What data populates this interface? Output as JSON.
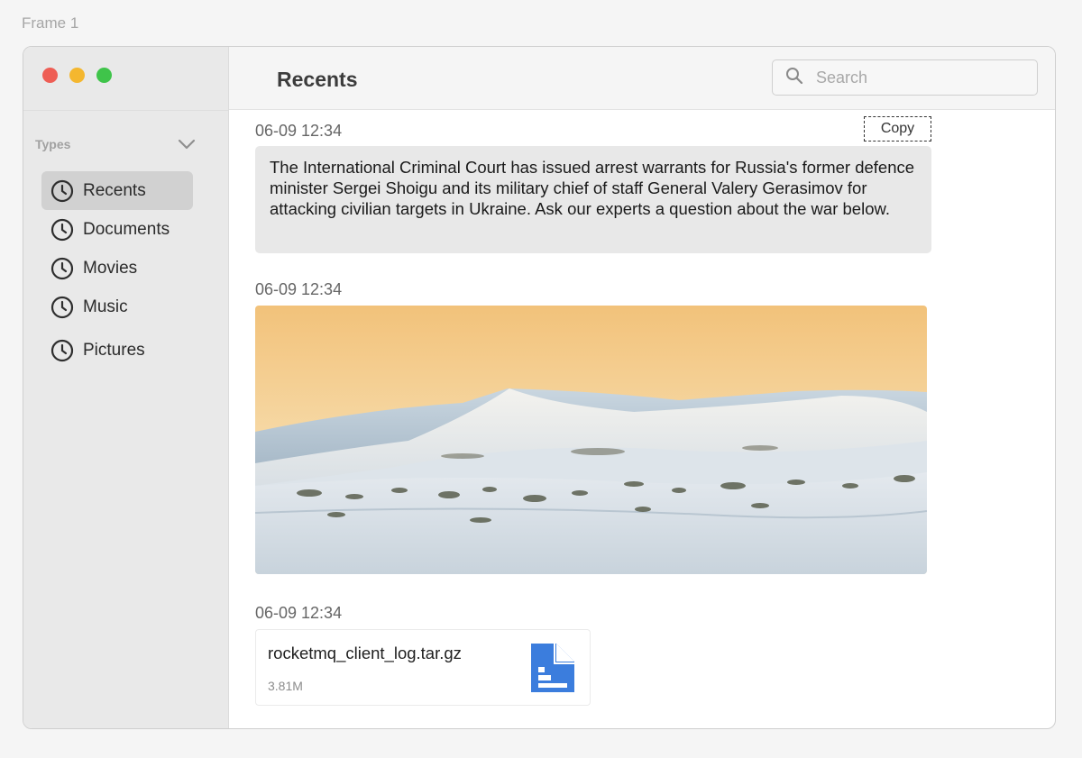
{
  "frame_label": "Frame 1",
  "sidebar": {
    "group_title": "Types",
    "items": [
      {
        "label": "Recents",
        "active": true,
        "icon": "clock-icon"
      },
      {
        "label": "Documents",
        "active": false,
        "icon": "clock-icon"
      },
      {
        "label": "Movies",
        "active": false,
        "icon": "clock-icon"
      },
      {
        "label": "Music",
        "active": false,
        "icon": "clock-icon"
      },
      {
        "label": "Pictures",
        "active": false,
        "icon": "clock-icon"
      }
    ]
  },
  "header": {
    "title": "Recents",
    "search_placeholder": "Search"
  },
  "messages": [
    {
      "timestamp": "06-09 12:34",
      "type": "text",
      "copy_label": "Copy",
      "text": "The International Criminal Court has issued arrest warrants for Russia's former defence minister Sergei Shoigu and its military chief of staff General Valery Gerasimov for attacking civilian targets in Ukraine. Ask our experts a question about the war below."
    },
    {
      "timestamp": "06-09 12:34",
      "type": "image"
    },
    {
      "timestamp": "06-09 12:34",
      "type": "file",
      "file_name": "rocketmq_client_log.tar.gz",
      "file_size": "3.81M",
      "icon": "document-icon"
    }
  ],
  "colors": {
    "traffic_red": "#ee5e55",
    "traffic_yellow": "#f4b72f",
    "traffic_green": "#3fc44a",
    "file_icon_blue": "#3b7ddd",
    "active_nav_bg": "#d1d1d1"
  }
}
